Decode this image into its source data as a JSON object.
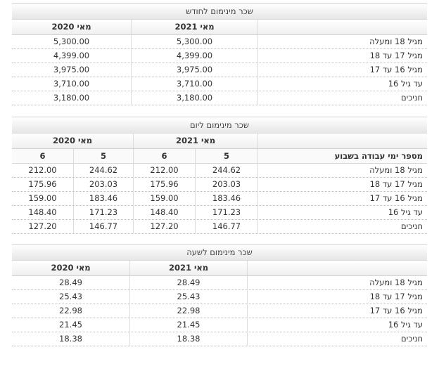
{
  "monthly": {
    "title": "שכר מינימום לחודש",
    "col_2021": "מאי 2021",
    "col_2020": "מאי 2020",
    "rows": [
      {
        "label": "מגיל 18 ומעלה",
        "v2021": "5,300.00",
        "v2020": "5,300.00"
      },
      {
        "label": "מגיל 17 עד 18",
        "v2021": "4,399.00",
        "v2020": "4,399.00"
      },
      {
        "label": "מגיל 16 עד 17",
        "v2021": "3,975.00",
        "v2020": "3,975.00"
      },
      {
        "label": "עד גיל 16",
        "v2021": "3,710.00",
        "v2020": "3,710.00"
      },
      {
        "label": "חניכים",
        "v2021": "3,180.00",
        "v2020": "3,180.00"
      }
    ]
  },
  "daily": {
    "title": "שכר מינימום ליום",
    "col_2021": "מאי 2021",
    "col_2020": "מאי 2020",
    "days_label": "מספר ימי עבודה בשבוע",
    "d5": "5",
    "d6": "6",
    "rows": [
      {
        "label": "מגיל 18 ומעלה",
        "a5": "244.62",
        "a6": "212.00",
        "b5": "244.62",
        "b6": "212.00"
      },
      {
        "label": "מגיל 17 עד 18",
        "a5": "203.03",
        "a6": "175.96",
        "b5": "203.03",
        "b6": "175.96"
      },
      {
        "label": "מגיל 16 עד 17",
        "a5": "183.46",
        "a6": "159.00",
        "b5": "183.46",
        "b6": "159.00"
      },
      {
        "label": "עד גיל 16",
        "a5": "171.23",
        "a6": "148.40",
        "b5": "171.23",
        "b6": "148.40"
      },
      {
        "label": "חניכים",
        "a5": "146.77",
        "a6": "127.20",
        "b5": "146.77",
        "b6": "127.20"
      }
    ]
  },
  "hourly": {
    "title": "שכר מינימום לשעה",
    "col_2021": "מאי 2021",
    "col_2020": "מאי 2020",
    "rows": [
      {
        "label": "מגיל 18 ומעלה",
        "v2021": "28.49",
        "v2020": "28.49"
      },
      {
        "label": "מגיל 17 עד 18",
        "v2021": "25.43",
        "v2020": "25.43"
      },
      {
        "label": "מגיל 16 עד 17",
        "v2021": "22.98",
        "v2020": "22.98"
      },
      {
        "label": "עד גיל 16",
        "v2021": "21.45",
        "v2020": "21.45"
      },
      {
        "label": "חניכים",
        "v2021": "18.38",
        "v2020": "18.38"
      }
    ]
  }
}
